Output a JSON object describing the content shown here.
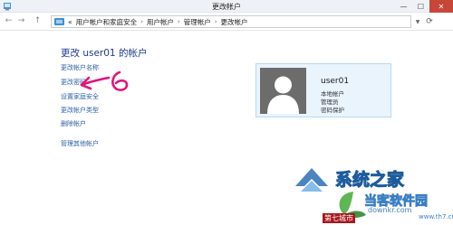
{
  "window": {
    "title": "更改帐户"
  },
  "titlebar_buttons": {
    "minimize": "—",
    "maximize": "☐",
    "close": "✕"
  },
  "address_bar": {
    "back": "←",
    "forward": "→",
    "up": "↑",
    "breadcrumbs": [
      "«",
      "用户帐户和家庭安全",
      "用户帐户",
      "管理帐户",
      "更改帐户"
    ],
    "separator": "›"
  },
  "page": {
    "title": "更改 user01 的帐户"
  },
  "links": [
    "更改帐户名称",
    "更改密码",
    "设置家庭安全",
    "更改帐户类型",
    "删除帐户",
    "管理其他帐户"
  ],
  "account": {
    "name": "user01",
    "details": [
      "本地帐户",
      "管理员",
      "密码保护"
    ]
  },
  "annotation": {
    "color": "#e0167a"
  },
  "watermark": {
    "text1": "系统之家",
    "text2": "当客软件园",
    "url": "downkr.com",
    "tag": "第七城市",
    "tag2": "www.th7.cn"
  }
}
